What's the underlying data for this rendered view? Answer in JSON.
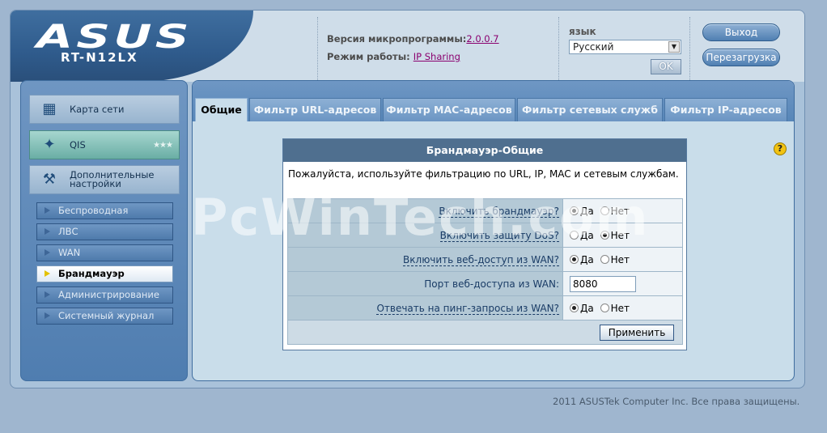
{
  "brand": {
    "logo": "ASUS",
    "model": "RT-N12LX"
  },
  "firmware": {
    "version_label": "Версия микропрограммы:",
    "version_value": "2.0.0.7",
    "mode_label": "Режим работы:",
    "mode_value": "IP Sharing"
  },
  "language": {
    "label": "язык",
    "selected": "Русский",
    "ok_label": "OK"
  },
  "buttons": {
    "logout": "Выход",
    "reboot": "Перезагрузка"
  },
  "sidebar": {
    "main": [
      {
        "label": "Карта сети",
        "icon": "network-map-icon"
      },
      {
        "label": "QIS",
        "icon": "magic-wand-icon"
      },
      {
        "label": "Дополнительные настройки",
        "icon": "tools-icon"
      }
    ],
    "sub": [
      "Беспроводная",
      "ЛВС",
      "WAN",
      "Брандмауэр",
      "Администрирование",
      "Системный журнал"
    ]
  },
  "tabs": [
    "Общие",
    "Фильтр URL-адресов",
    "Фильтр MAC-адресов",
    "Фильтр сетевых служб",
    "Фильтр IP-адресов"
  ],
  "box": {
    "title": "Брандмауэр-Общие",
    "description": "Пожалуйста, используйте фильтрацию по URL, IP, MAC и сетевым службам.",
    "rows": [
      {
        "label": "Включить брандмауэр?",
        "yes": "Да",
        "no": "Нет",
        "selected": "yes"
      },
      {
        "label": "Включить защиту DoS?",
        "yes": "Да",
        "no": "Нет",
        "selected": "no"
      },
      {
        "label": "Включить веб-доступ из WAN?",
        "yes": "Да",
        "no": "Нет",
        "selected": "yes"
      },
      {
        "label": "Порт веб-доступа из WAN:",
        "value": "8080"
      },
      {
        "label": "Отвечать на пинг-запросы из WAN?",
        "yes": "Да",
        "no": "Нет",
        "selected": "yes"
      }
    ],
    "apply_label": "Применить"
  },
  "footer": "2011 ASUSTek Computer Inc. Все права защищены.",
  "watermark": "PcWinTech.com"
}
